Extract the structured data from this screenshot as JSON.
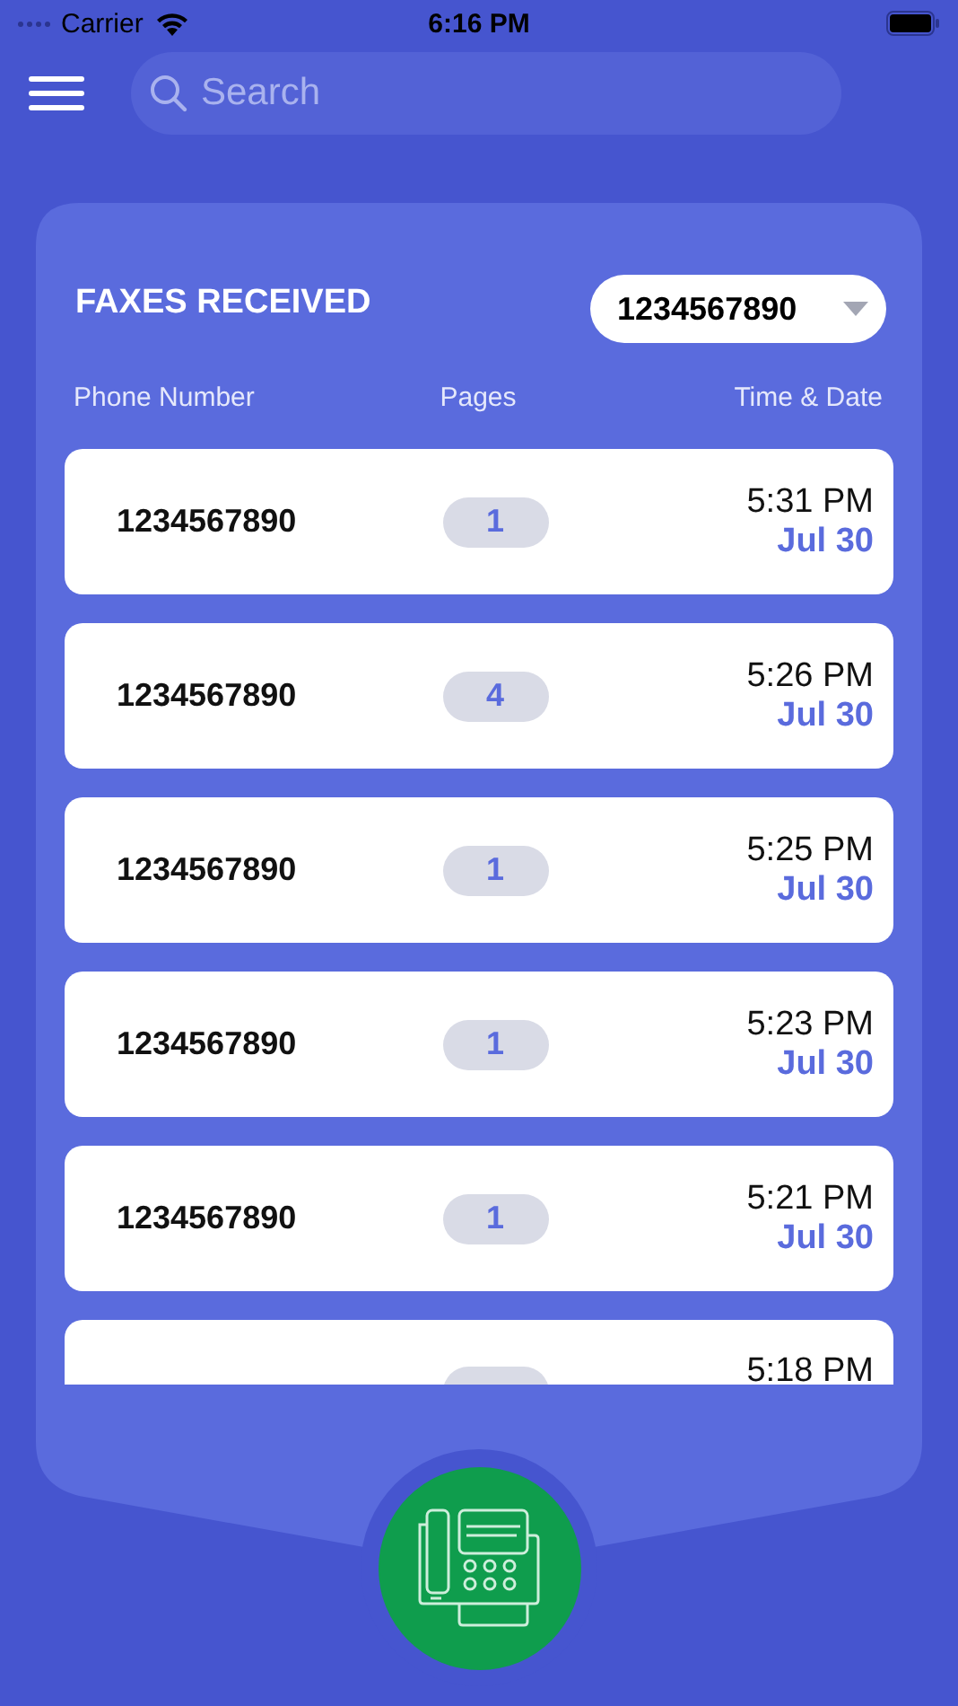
{
  "status_bar": {
    "carrier": "Carrier",
    "time": "6:16 PM"
  },
  "search": {
    "placeholder": "Search"
  },
  "panel": {
    "title": "FAXES RECEIVED",
    "number_dropdown": "1234567890"
  },
  "columns": [
    "Phone Number",
    "Pages",
    "Time & Date"
  ],
  "rows": [
    {
      "phone": "1234567890",
      "pages": "1",
      "time": "5:31 PM",
      "date": "Jul 30"
    },
    {
      "phone": "1234567890",
      "pages": "4",
      "time": "5:26 PM",
      "date": "Jul 30"
    },
    {
      "phone": "1234567890",
      "pages": "1",
      "time": "5:25 PM",
      "date": "Jul 30"
    },
    {
      "phone": "1234567890",
      "pages": "1",
      "time": "5:23 PM",
      "date": "Jul 30"
    },
    {
      "phone": "1234567890",
      "pages": "1",
      "time": "5:21 PM",
      "date": "Jul 30"
    },
    {
      "time": "5:18 PM"
    }
  ]
}
